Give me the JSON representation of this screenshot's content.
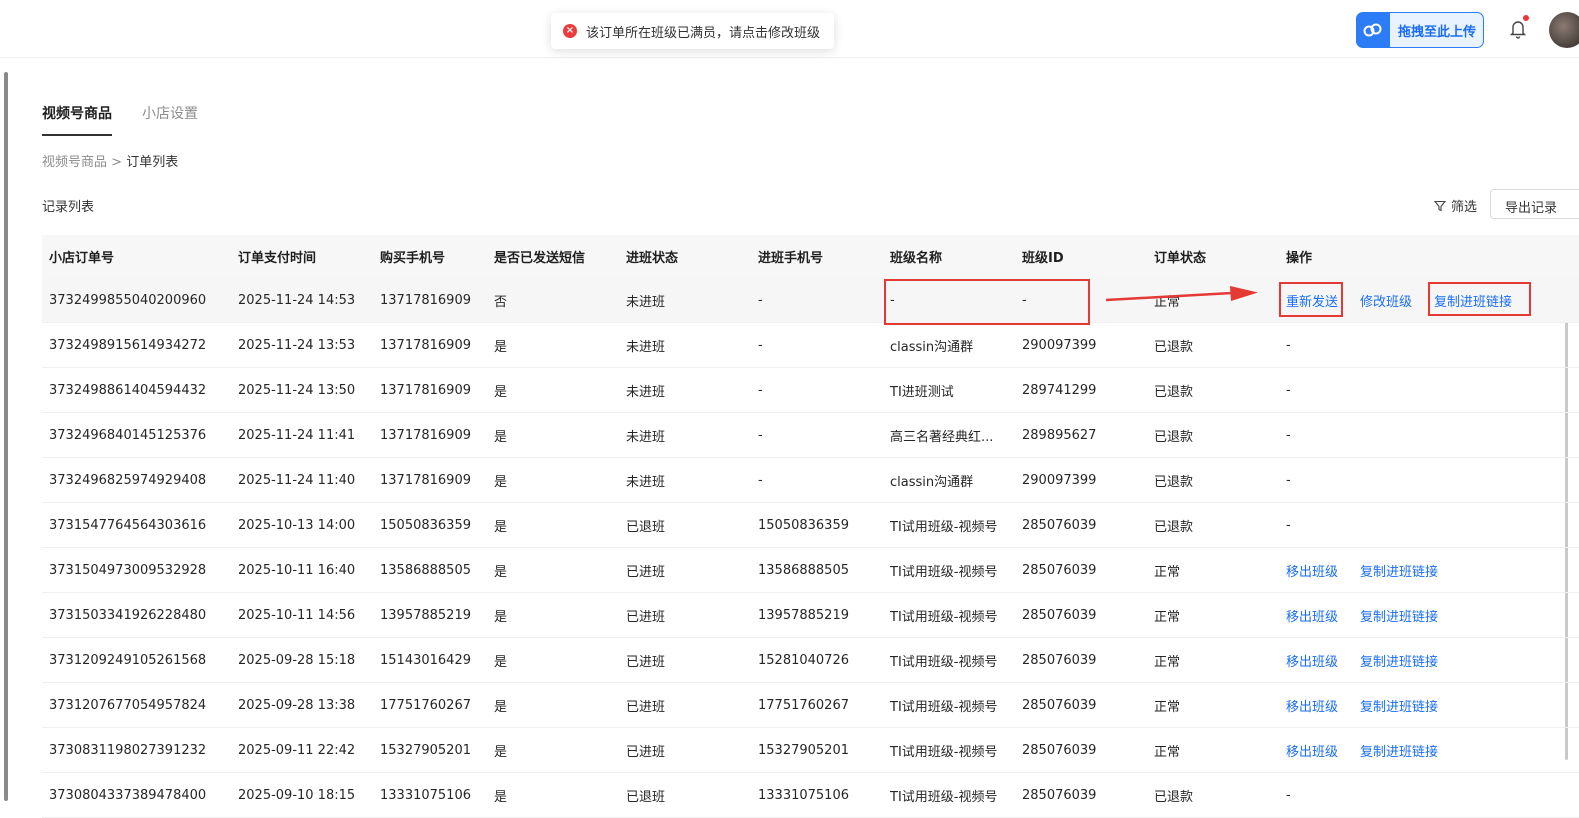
{
  "toast": {
    "message": "该订单所在班级已满员，请点击修改班级"
  },
  "header": {
    "upload_label": "拖拽至此上传"
  },
  "tabs": [
    {
      "label": "视频号商品"
    },
    {
      "label": "小店设置"
    }
  ],
  "breadcrumb": {
    "parent": "视频号商品",
    "separator": ">",
    "current": "订单列表"
  },
  "section": {
    "title": "记录列表",
    "filter_label": "筛选",
    "export_label": "导出记录"
  },
  "table": {
    "columns": [
      "小店订单号",
      "订单支付时间",
      "购买手机号",
      "是否已发送短信",
      "进班状态",
      "进班手机号",
      "班级名称",
      "班级ID",
      "订单状态",
      "操作"
    ],
    "rows": [
      {
        "order_no": "3732499855040200960",
        "pay_time": "2025-11-24 14:53",
        "buy_phone": "13717816909",
        "sms": "否",
        "join_status": "未进班",
        "join_phone": "-",
        "class_name": "-",
        "class_id": "-",
        "status": "正常",
        "actions": [
          "重新发送",
          "修改班级",
          "复制进班链接"
        ]
      },
      {
        "order_no": "3732498915614934272",
        "pay_time": "2025-11-24 13:53",
        "buy_phone": "13717816909",
        "sms": "是",
        "join_status": "未进班",
        "join_phone": "-",
        "class_name": "classin沟通群",
        "class_id": "290097399",
        "status": "已退款",
        "actions": [
          "-"
        ]
      },
      {
        "order_no": "3732498861404594432",
        "pay_time": "2025-11-24 13:50",
        "buy_phone": "13717816909",
        "sms": "是",
        "join_status": "未进班",
        "join_phone": "-",
        "class_name": "TI进班测试",
        "class_id": "289741299",
        "status": "已退款",
        "actions": [
          "-"
        ]
      },
      {
        "order_no": "3732496840145125376",
        "pay_time": "2025-11-24 11:41",
        "buy_phone": "13717816909",
        "sms": "是",
        "join_status": "未进班",
        "join_phone": "-",
        "class_name": "高三名著经典红...",
        "class_id": "289895627",
        "status": "已退款",
        "actions": [
          "-"
        ]
      },
      {
        "order_no": "3732496825974929408",
        "pay_time": "2025-11-24 11:40",
        "buy_phone": "13717816909",
        "sms": "是",
        "join_status": "未进班",
        "join_phone": "-",
        "class_name": "classin沟通群",
        "class_id": "290097399",
        "status": "已退款",
        "actions": [
          "-"
        ]
      },
      {
        "order_no": "3731547764564303616",
        "pay_time": "2025-10-13 14:00",
        "buy_phone": "15050836359",
        "sms": "是",
        "join_status": "已退班",
        "join_phone": "15050836359",
        "class_name": "TI试用班级-视频号",
        "class_id": "285076039",
        "status": "已退款",
        "actions": [
          "-"
        ]
      },
      {
        "order_no": "3731504973009532928",
        "pay_time": "2025-10-11 16:40",
        "buy_phone": "13586888505",
        "sms": "是",
        "join_status": "已进班",
        "join_phone": "13586888505",
        "class_name": "TI试用班级-视频号",
        "class_id": "285076039",
        "status": "正常",
        "actions": [
          "移出班级",
          "复制进班链接"
        ]
      },
      {
        "order_no": "3731503341926228480",
        "pay_time": "2025-10-11 14:56",
        "buy_phone": "13957885219",
        "sms": "是",
        "join_status": "已进班",
        "join_phone": "13957885219",
        "class_name": "TI试用班级-视频号",
        "class_id": "285076039",
        "status": "正常",
        "actions": [
          "移出班级",
          "复制进班链接"
        ]
      },
      {
        "order_no": "3731209249105261568",
        "pay_time": "2025-09-28 15:18",
        "buy_phone": "15143016429",
        "sms": "是",
        "join_status": "已进班",
        "join_phone": "15281040726",
        "class_name": "TI试用班级-视频号",
        "class_id": "285076039",
        "status": "正常",
        "actions": [
          "移出班级",
          "复制进班链接"
        ]
      },
      {
        "order_no": "3731207677054957824",
        "pay_time": "2025-09-28 13:38",
        "buy_phone": "17751760267",
        "sms": "是",
        "join_status": "已进班",
        "join_phone": "17751760267",
        "class_name": "TI试用班级-视频号",
        "class_id": "285076039",
        "status": "正常",
        "actions": [
          "移出班级",
          "复制进班链接"
        ]
      },
      {
        "order_no": "3730831198027391232",
        "pay_time": "2025-09-11 22:42",
        "buy_phone": "15327905201",
        "sms": "是",
        "join_status": "已进班",
        "join_phone": "15327905201",
        "class_name": "TI试用班级-视频号",
        "class_id": "285076039",
        "status": "正常",
        "actions": [
          "移出班级",
          "复制进班链接"
        ]
      },
      {
        "order_no": "3730804337389478400",
        "pay_time": "2025-09-10 18:15",
        "buy_phone": "13331075106",
        "sms": "是",
        "join_status": "已退班",
        "join_phone": "13331075106",
        "class_name": "TI试用班级-视频号",
        "class_id": "285076039",
        "status": "已退款",
        "actions": [
          "-"
        ]
      }
    ]
  },
  "colors": {
    "accent": "#1a6ef5",
    "annotation": "#e53935",
    "error": "#ee3b3b"
  },
  "icons": [
    "error-icon",
    "cloud-upload-icon",
    "bell-icon",
    "filter-icon",
    "annotation-arrow-icon"
  ]
}
